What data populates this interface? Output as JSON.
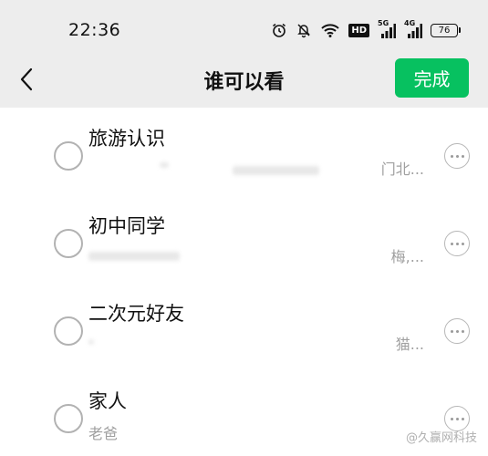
{
  "status_bar": {
    "time": "22:36",
    "hd": "HD",
    "net1": "5G",
    "net2": "4G",
    "battery": "76"
  },
  "nav": {
    "title": "谁可以看",
    "done_label": "完成"
  },
  "groups": [
    {
      "title": "旅游认识",
      "subtitle": "",
      "right": "门北..."
    },
    {
      "title": "初中同学",
      "subtitle": "",
      "right": "梅,..."
    },
    {
      "title": "二次元好友",
      "subtitle": "",
      "right": "猫..."
    },
    {
      "title": "家人",
      "subtitle": "老爸",
      "right": ""
    }
  ],
  "watermark": "@久赢网科技",
  "colors": {
    "accent": "#07c160",
    "background": "#ededed",
    "list_background": "#ffffff",
    "secondary_text": "#a0a0a0"
  },
  "icons": {
    "back": "chevron-left-icon",
    "more": "ellipsis-circle-icon",
    "alarm": "alarm-icon",
    "mute": "bell-off-icon",
    "wifi": "wifi-icon"
  }
}
